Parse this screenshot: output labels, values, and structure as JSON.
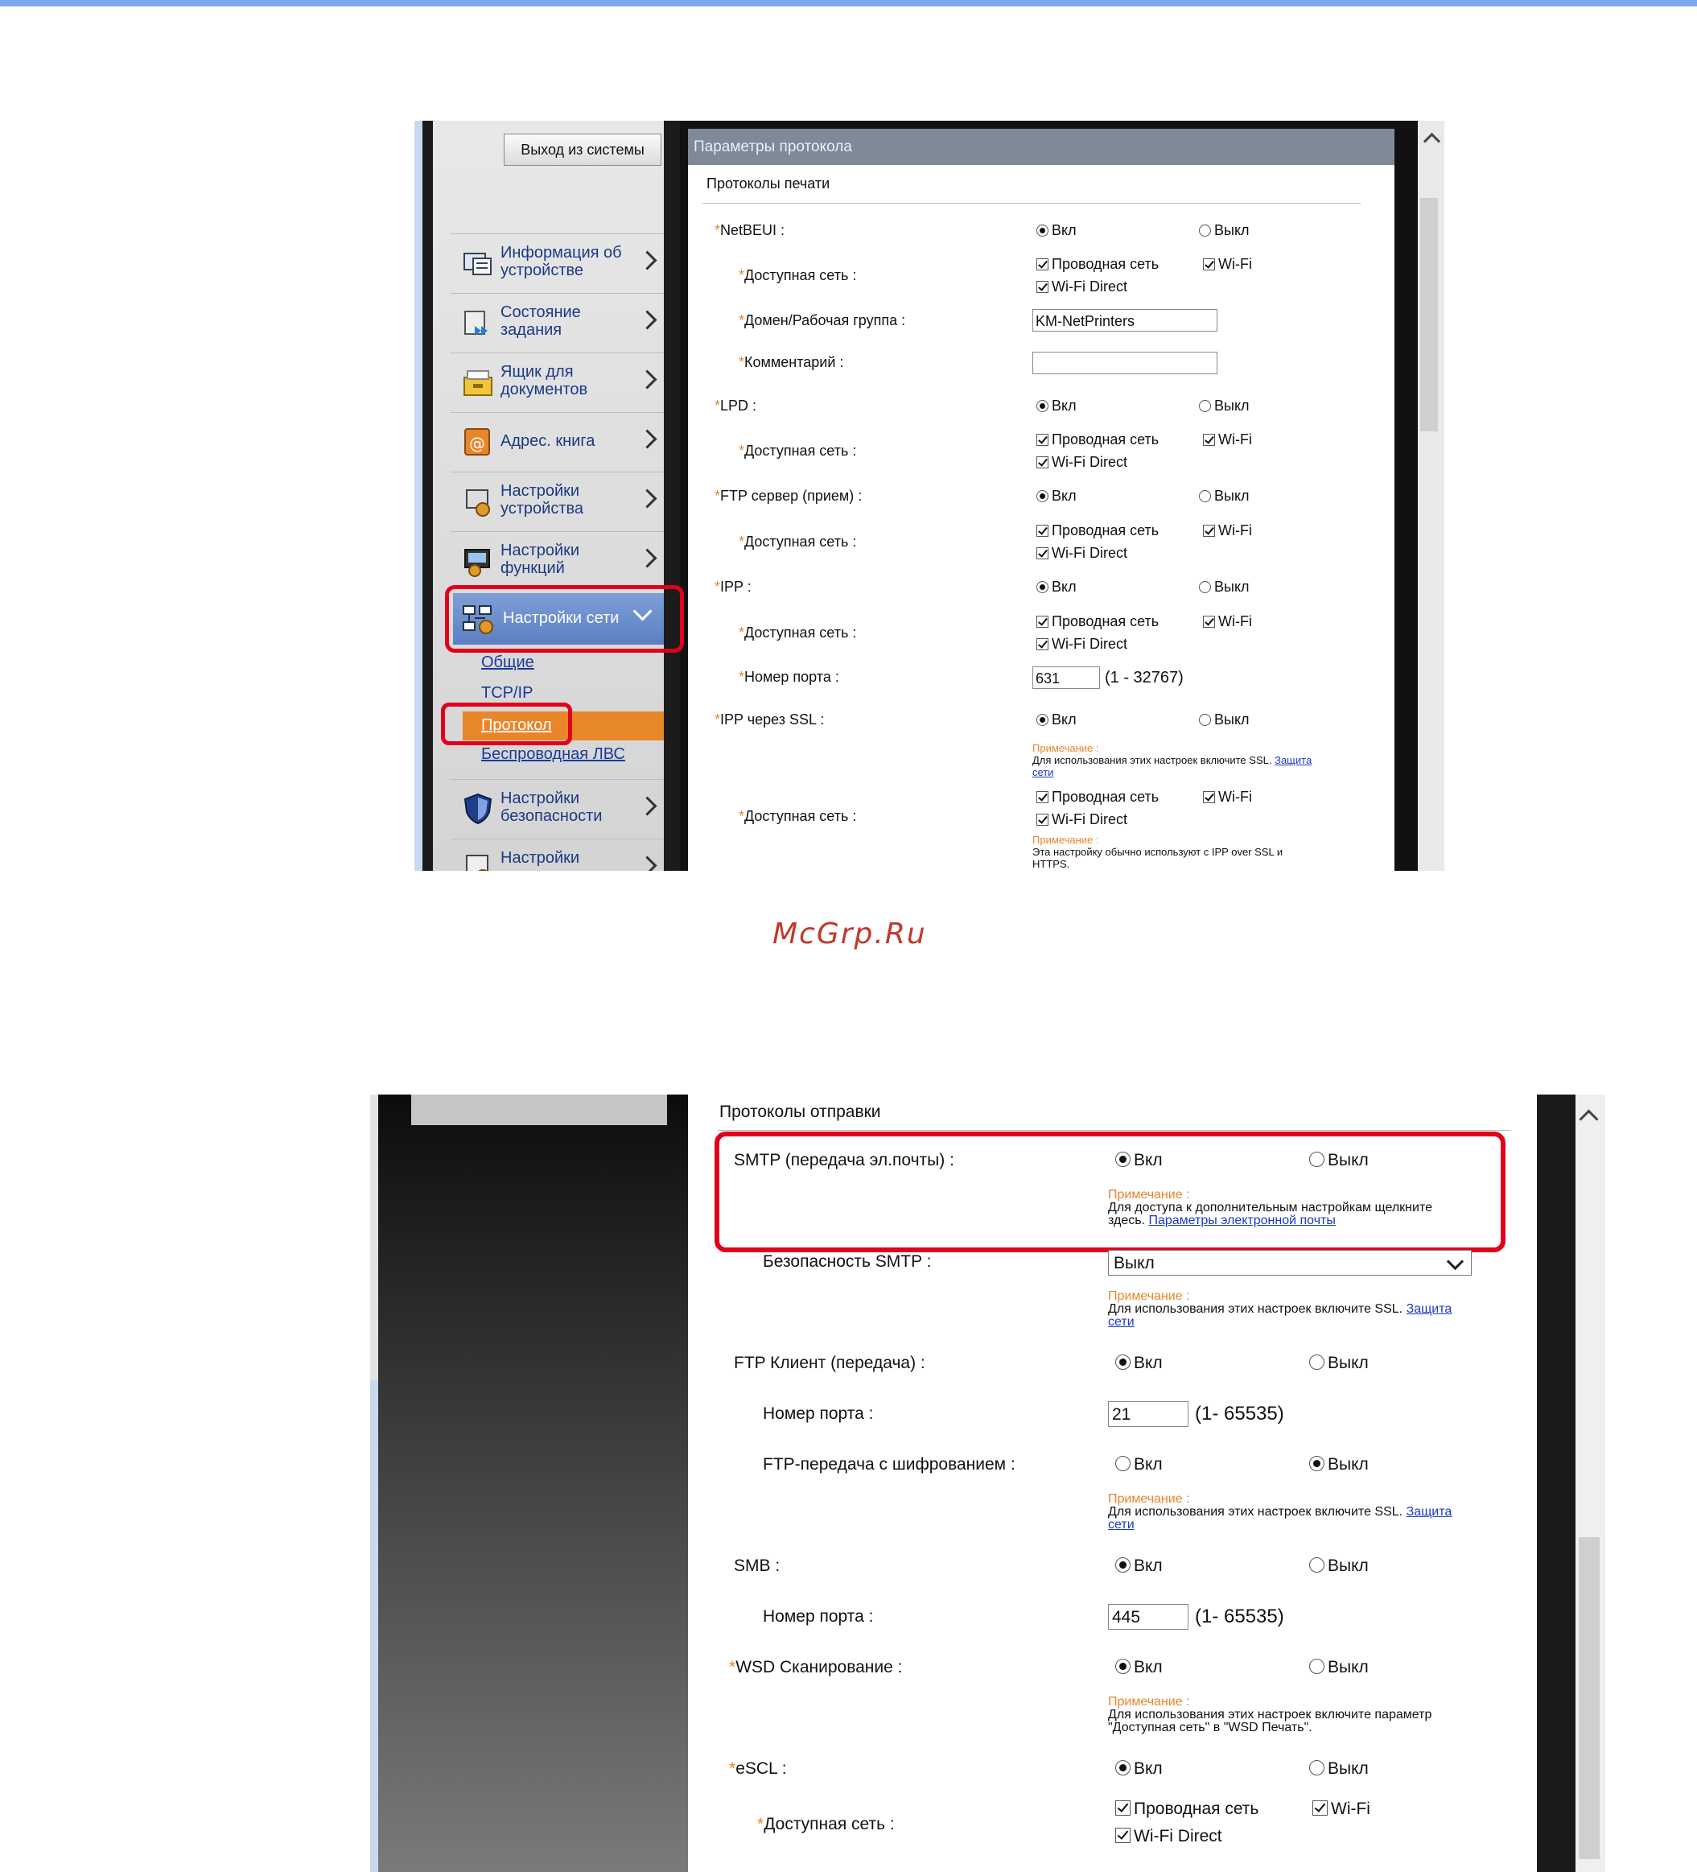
{
  "watermark": "McGrp.Ru",
  "screen1": {
    "logout_label": "Выход из системы",
    "panel_title": "Параметры протокола",
    "section_title": "Протоколы печати",
    "sidebar": {
      "items": [
        {
          "label": "Информация об устройстве",
          "icon": "device-info-icon"
        },
        {
          "label": "Состояние задания",
          "icon": "job-status-icon"
        },
        {
          "label": "Ящик для документов",
          "icon": "document-box-icon"
        },
        {
          "label": "Адрес. книга",
          "icon": "address-book-icon"
        },
        {
          "label": "Настройки устройства",
          "icon": "device-settings-icon"
        },
        {
          "label": "Настройки функций",
          "icon": "function-settings-icon"
        },
        {
          "label": "Настройки сети",
          "icon": "network-settings-icon"
        },
        {
          "label": "Настройки безопасности",
          "icon": "security-shield-icon"
        },
        {
          "label": "Настройки управления",
          "icon": "management-settings-icon"
        }
      ],
      "sub_items": [
        "Общие",
        "TCP/IP",
        "Протокол",
        "Беспроводная ЛВС"
      ]
    },
    "options": {
      "on": "Вкл",
      "off": "Выкл",
      "wired": "Проводная сеть",
      "wifi": "Wi-Fi",
      "wifi_direct": "Wi-Fi Direct"
    },
    "rows": {
      "netbeui": "NetBEUI :",
      "avail_net": "Доступная сеть :",
      "domain": "Домен/Рабочая группа :",
      "domain_value": "KM-NetPrinters",
      "comment": "Комментарий :",
      "comment_value": "",
      "lpd": "LPD :",
      "ftp_server": "FTP сервер (прием) :",
      "ipp": "IPP :",
      "port": "Номер порта :",
      "ipp_port_value": "631",
      "ipp_port_range": "(1 - 32767)",
      "ipp_ssl": "IPP через SSL :"
    },
    "notes": {
      "label": "Примечание :",
      "ssl_text": "Для использования этих настроек включите SSL.",
      "ssl_link1": "Защита",
      "ssl_link2": "сети",
      "ipp_text1": "Эта настройку обычно используют с IPP over SSL и",
      "ipp_text2": "HTTPS."
    }
  },
  "screen2": {
    "section_title": "Протоколы отправки",
    "options": {
      "on": "Вкл",
      "off": "Выкл",
      "wired": "Проводная сеть",
      "wifi": "Wi-Fi",
      "wifi_direct": "Wi-Fi Direct"
    },
    "rows": {
      "smtp": "SMTP (передача эл.почты) :",
      "smtp_security": "Безопасность SMTP :",
      "smtp_security_value": "Выкл",
      "ftp_client": "FTP Клиент (передача) :",
      "port": "Номер порта :",
      "ftp_port_value": "21",
      "port_range": "(1- 65535)",
      "ftp_encrypt": "FTP-передача с шифрованием :",
      "smb": "SMB :",
      "smb_port_value": "445",
      "wsd_scan": "WSD Сканирование :",
      "escl": "eSCL :",
      "avail_net": "Доступная сеть :"
    },
    "notes": {
      "label": "Примечание :",
      "smtp_text1": "Для доступа к дополнительным настройкам щелкните",
      "smtp_text2": "здесь.",
      "smtp_link": "Параметры электронной почты",
      "ssl_text": "Для использования этих настроек включите SSL.",
      "ssl_link1": "Защита",
      "ssl_link2": "сети",
      "wsd_text1": "Для использования этих настроек включите параметр",
      "wsd_text2": "\"Доступная сеть\" в \"WSD Печать\"."
    }
  }
}
